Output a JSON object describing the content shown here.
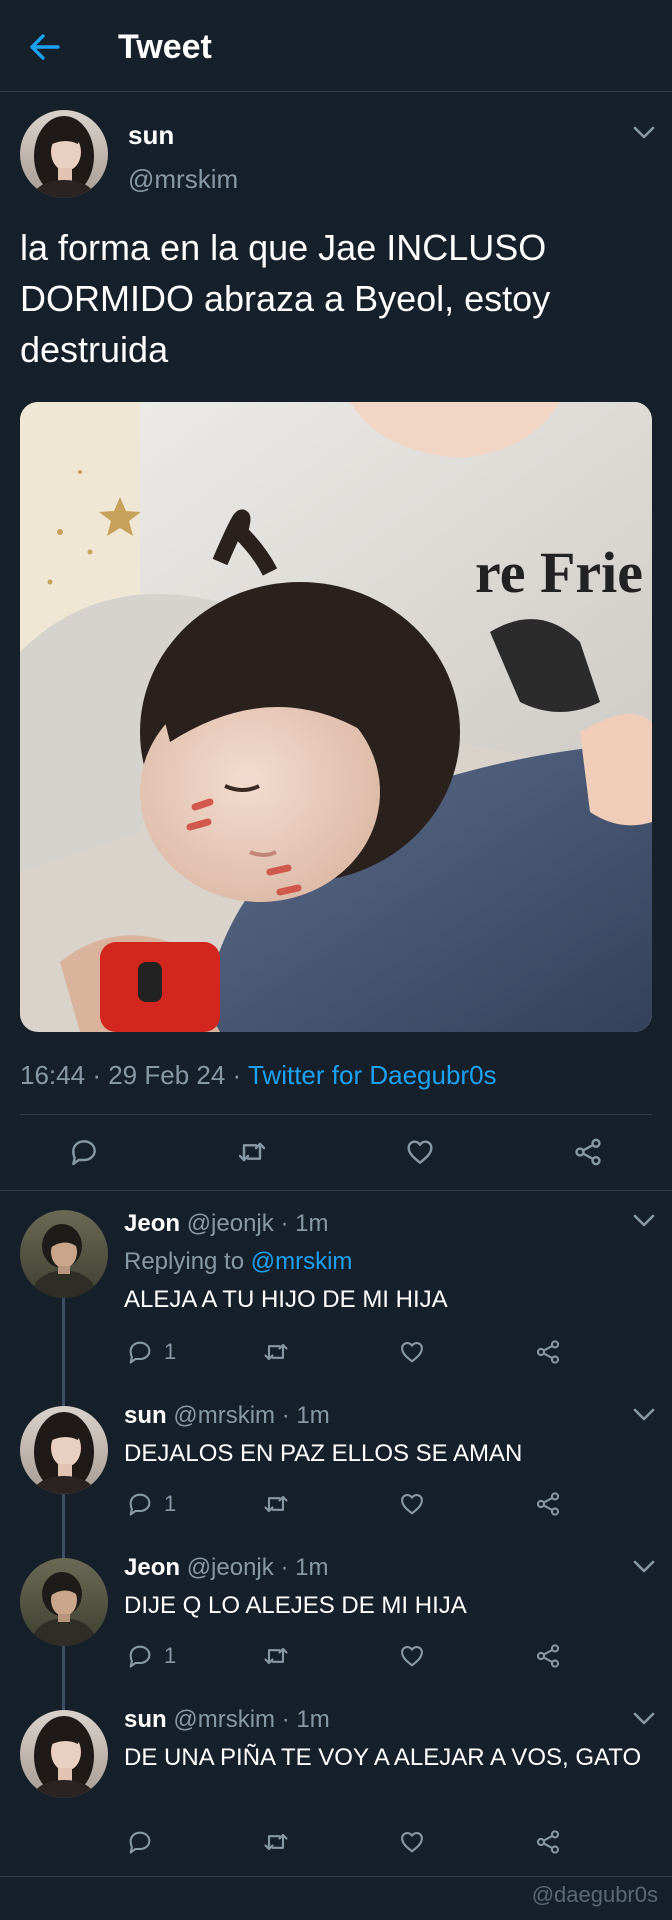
{
  "header": {
    "title": "Tweet",
    "back_icon": "arrow-left-icon"
  },
  "tweet": {
    "name": "sun",
    "handle": "@mrskim",
    "text": "la forma en la que Jae INCLUSO DORMIDO abraza a Byeol, estoy destruida",
    "image": "photo of a sleeping toddler with face paint resting on a person wearing jeans and a graphic t-shirt",
    "time": "16:44",
    "date": "29 Feb 24",
    "client": "Twitter for Daegubr0s",
    "sep": "·"
  },
  "replies": [
    {
      "name": "Jeon",
      "handle": "@jeonjk",
      "time": "1m",
      "replying_label": "Replying to",
      "replying_to": "@mrskim",
      "text": "ALEJA A TU HIJO DE MI HIJA",
      "reply_count": "1"
    },
    {
      "name": "sun",
      "handle": "@mrskim",
      "time": "1m",
      "text": "DEJALOS EN PAZ ELLOS SE AMAN",
      "reply_count": "1"
    },
    {
      "name": "Jeon",
      "handle": "@jeonjk",
      "time": "1m",
      "text": "DIJE Q LO ALEJES DE MI HIJA",
      "reply_count": "1"
    },
    {
      "name": "sun",
      "handle": "@mrskim",
      "time": "1m",
      "text": "DE UNA PIÑA TE VOY A ALEJAR A VOS, GATO",
      "reply_count": ""
    }
  ],
  "watermark": "@daegubr0s",
  "colors": {
    "background": "#15202b",
    "accent": "#1da1f2",
    "muted": "#8899a6",
    "divider": "#2f3b47"
  }
}
